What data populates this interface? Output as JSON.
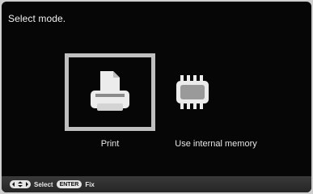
{
  "screen": {
    "prompt": "Select mode."
  },
  "options": [
    {
      "label": "Print",
      "icon": "printer-icon",
      "selected": true
    },
    {
      "label": "Use internal memory",
      "icon": "memory-chip-icon",
      "selected": false
    }
  ],
  "footer": {
    "nav_icon": "four-way-arrows-icon",
    "select_label": "Select",
    "enter_key": "ENTER",
    "fix_label": "Fix"
  },
  "colors": {
    "background": "#060606",
    "icon_fill": "#ececec",
    "highlight_border": "#bfbfbf"
  }
}
